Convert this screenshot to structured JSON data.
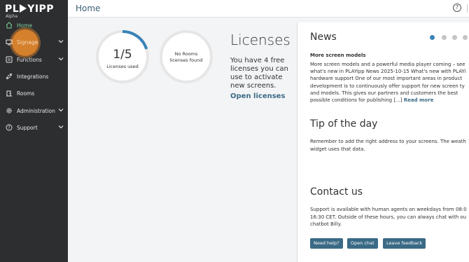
{
  "app": {
    "logo_text": "PLAYIPP",
    "logo_prefix": "PL",
    "logo_suffix": "YIPP",
    "badge": "Alpha"
  },
  "sidebar": {
    "items": [
      {
        "label": "Home",
        "icon": "home-icon",
        "active": true
      },
      {
        "label": "Signage",
        "icon": "signage-icon",
        "has_children": true
      },
      {
        "label": "Functions",
        "icon": "functions-icon",
        "has_children": true
      },
      {
        "label": "Integrations",
        "icon": "integrations-icon"
      },
      {
        "label": "Rooms",
        "icon": "rooms-icon"
      },
      {
        "label": "Administration",
        "icon": "gear-icon",
        "has_children": true
      },
      {
        "label": "Support",
        "icon": "help-icon",
        "has_children": true
      }
    ]
  },
  "header": {
    "title": "Home",
    "help_glyph": "?"
  },
  "licenses": {
    "used_value": "1/5",
    "used_label": "Licenses used",
    "used_fraction": 0.2,
    "rooms_label_line1": "No Rooms",
    "rooms_label_line2": "licenses found",
    "title": "Licenses",
    "text": "You have 4 free licenses you can use to activate new screens.",
    "link": "Open licenses"
  },
  "news": {
    "title": "News",
    "subtitle": "More screen models",
    "lines": [
      "More screen models and a powerful media player coming – see",
      "what's new in PLAYipp News 2025-10-15 What's new with PLAYi",
      "hardware support One of our most important areas in product",
      "development is to continuously offer support for new screen ty",
      "and models. This gives our partners and customers the best"
    ],
    "last_line": "possible conditions for publishing [...]",
    "read_more": "Read more",
    "dots": 4,
    "active_dot": 0
  },
  "tip": {
    "title": "Tip of the day",
    "lines": [
      "Remember to add the right address to your screens. The weath",
      "widget uses that data."
    ]
  },
  "contact": {
    "title": "Contact us",
    "lines": [
      "Support is available with human agents on weekdays from 08:0",
      "16:30 CET. Outside of these hours, you can always chat with ou",
      "chatbot Billy."
    ],
    "buttons": {
      "need_help": "Need help?",
      "open_chat": "Open chat",
      "feedback": "Leave feedback"
    }
  },
  "colors": {
    "sidebar_bg": "#2d2e30",
    "active_nav": "#7ed09b",
    "accent": "#3a6a85",
    "progress": "#3a84b8",
    "highlight": "#e88a2d"
  }
}
